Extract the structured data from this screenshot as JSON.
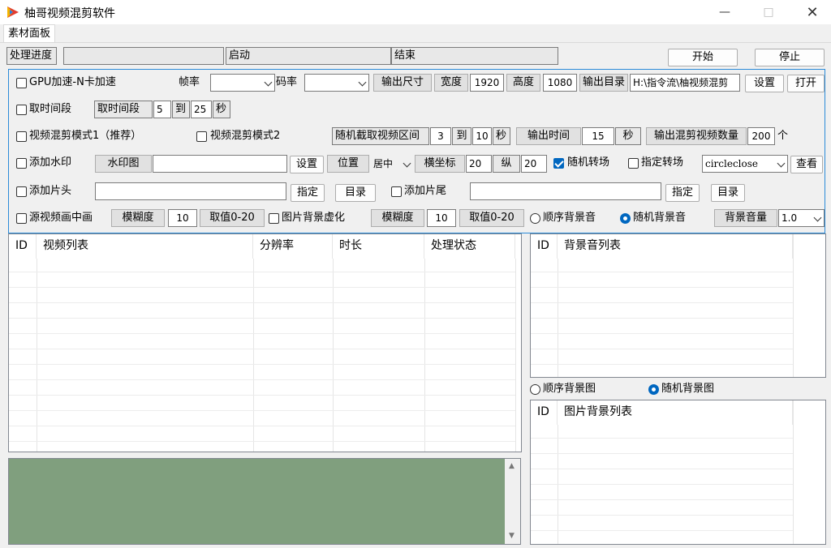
{
  "window": {
    "title": "柚哥视频混剪软件",
    "icon": "app-icon"
  },
  "tab": "素材面板",
  "progress": {
    "label": "处理进度",
    "start_label": "启动",
    "end_label": "结束",
    "start_button": "开始",
    "stop_button": "停止"
  },
  "row1": {
    "gpu_label": "GPU加速-N卡加速",
    "fps_label": "帧率",
    "fps_value": "",
    "bitrate_label": "码率",
    "bitrate_value": "",
    "output_size": "输出尺寸",
    "width_label": "宽度",
    "width_value": "1920",
    "height_label": "高度",
    "height_value": "1080",
    "output_dir_label": "输出目录",
    "output_dir_value": "H:\\指令流\\柚视频混剪",
    "settings_button": "设置",
    "open_button": "打开"
  },
  "row2": {
    "interval_cb": "取时间段",
    "interval_label": "取时间段",
    "from": "5",
    "to_label": "到",
    "to": "25",
    "unit": "秒"
  },
  "row3": {
    "mode1": "视频混剪模式1（推荐）",
    "mode2": "视频混剪模式2",
    "random_clip_label": "随机截取视频区间",
    "clip_from": "3",
    "to_label": "到",
    "clip_to": "10",
    "unit1": "秒",
    "output_time_label": "输出时间",
    "output_time": "15",
    "unit2": "秒",
    "output_count_label": "输出混剪视频数量",
    "output_count": "200",
    "count_unit": "个"
  },
  "row4": {
    "watermark_cb": "添加水印",
    "watermark_image_label": "水印图",
    "watermark_path": "",
    "settings_button": "设置",
    "position_label": "位置",
    "position_value": "居中",
    "x_label": "横坐标",
    "x_value": "20",
    "y_label": "纵",
    "y_value": "20",
    "random_transition": "随机转场",
    "specific_transition": "指定转场",
    "transition_value": "circleclose",
    "view_button": "查看"
  },
  "row5": {
    "intro_cb": "添加片头",
    "intro_path": "",
    "assign_button": "指定",
    "dir_button": "目录",
    "outro_cb": "添加片尾",
    "outro_path": "",
    "assign_button2": "指定",
    "dir_button2": "目录"
  },
  "row6": {
    "pip_cb": "源视频画中画",
    "blur_label": "模糊度",
    "blur_value": "10",
    "range_label": "取值0-20",
    "img_bg_cb": "图片背景虚化",
    "blur_label2": "模糊度",
    "blur_value2": "10",
    "range_label2": "取值0-20",
    "seq_bgm": "顺序背景音",
    "rand_bgm": "随机背景音",
    "bgm_volume_label": "背景音量",
    "bgm_volume": "1.0"
  },
  "video_list": {
    "columns": [
      "ID",
      "视频列表",
      "分辨率",
      "时长",
      "处理状态"
    ]
  },
  "bgm_list": {
    "columns": [
      "ID",
      "背景音列表"
    ]
  },
  "bg_image_mode": {
    "seq": "顺序背景图",
    "rand": "随机背景图"
  },
  "bg_image_list": {
    "columns": [
      "ID",
      "图片背景列表"
    ]
  },
  "colors": {
    "accent": "#0067c0",
    "log_bg": "#809f7e",
    "frame": "#2b8bd8"
  }
}
